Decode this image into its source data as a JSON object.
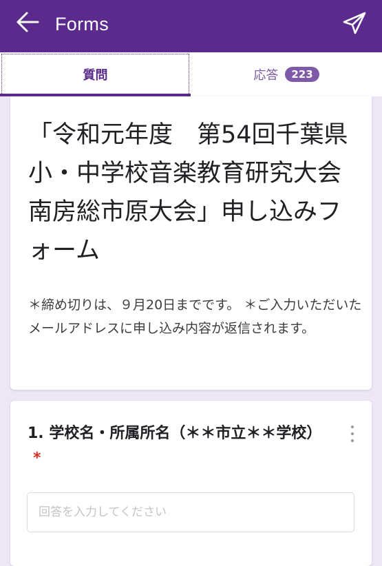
{
  "app_bar": {
    "title": "Forms",
    "back_icon": "arrow-left-icon",
    "send_icon": "send-paper-plane-icon",
    "background_color": "#5a2a8c"
  },
  "tabs": {
    "questions_label": "質問",
    "responses_label": "応答",
    "responses_count": "223",
    "active": "questions",
    "accent_color": "#5a2a8c"
  },
  "form": {
    "title": "「令和元年度　第54回千葉県小・中学校音楽教育研究大会南房総市原大会」申し込みフォーム",
    "description": "＊締め切りは、９月20日までです。 ＊ご入力いただいたメールアドレスに申し込み内容が返信されます。"
  },
  "questions": [
    {
      "title": "1. 学校名・所属所名（＊＊市立＊＊学校）",
      "required_mark": "*",
      "input_placeholder": "回答を入力してください",
      "input_value": "",
      "menu_icon": "more-vertical-icon"
    }
  ]
}
